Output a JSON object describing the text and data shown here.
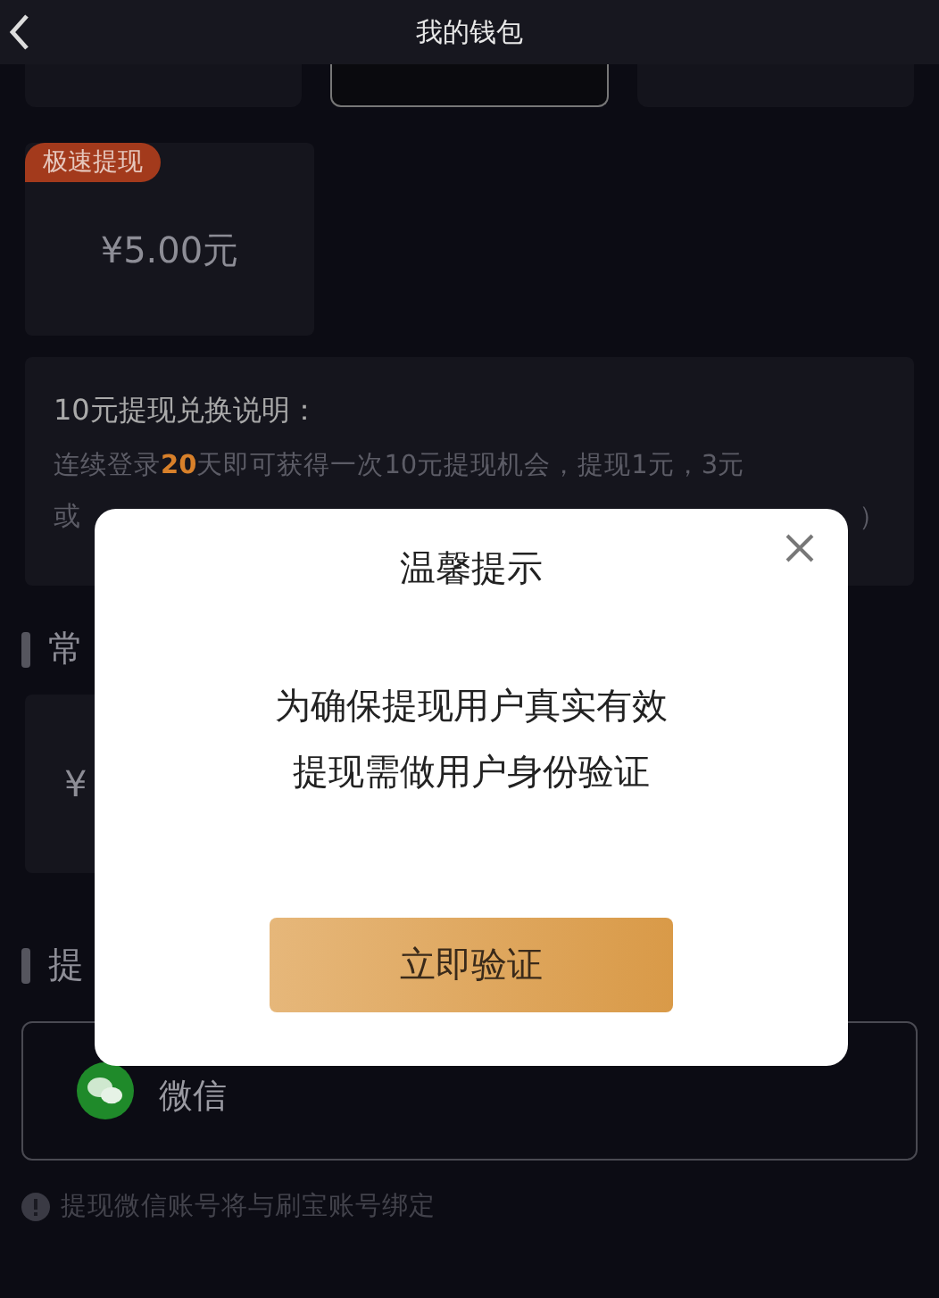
{
  "header": {
    "title": "我的钱包"
  },
  "fast_withdraw": {
    "badge": "极速提现",
    "amount": "¥5.00元"
  },
  "explanation": {
    "title": "10元提现兑换说明：",
    "line_1": "连续登录**20**天即可获得一次10元提现机会，提现1元，3元",
    "line_2_start": "或",
    "line_2_end": "）"
  },
  "common_section": {
    "title": "常",
    "amount": "¥"
  },
  "withdraw_section": {
    "title": "提",
    "method": "微信",
    "note": "提现微信账号将与刷宝账号绑定"
  },
  "dialog": {
    "title": "温馨提示",
    "message": [
      "为确保提现用户真实有效",
      "提现需做用户身份验证"
    ],
    "button": "立即验证"
  }
}
